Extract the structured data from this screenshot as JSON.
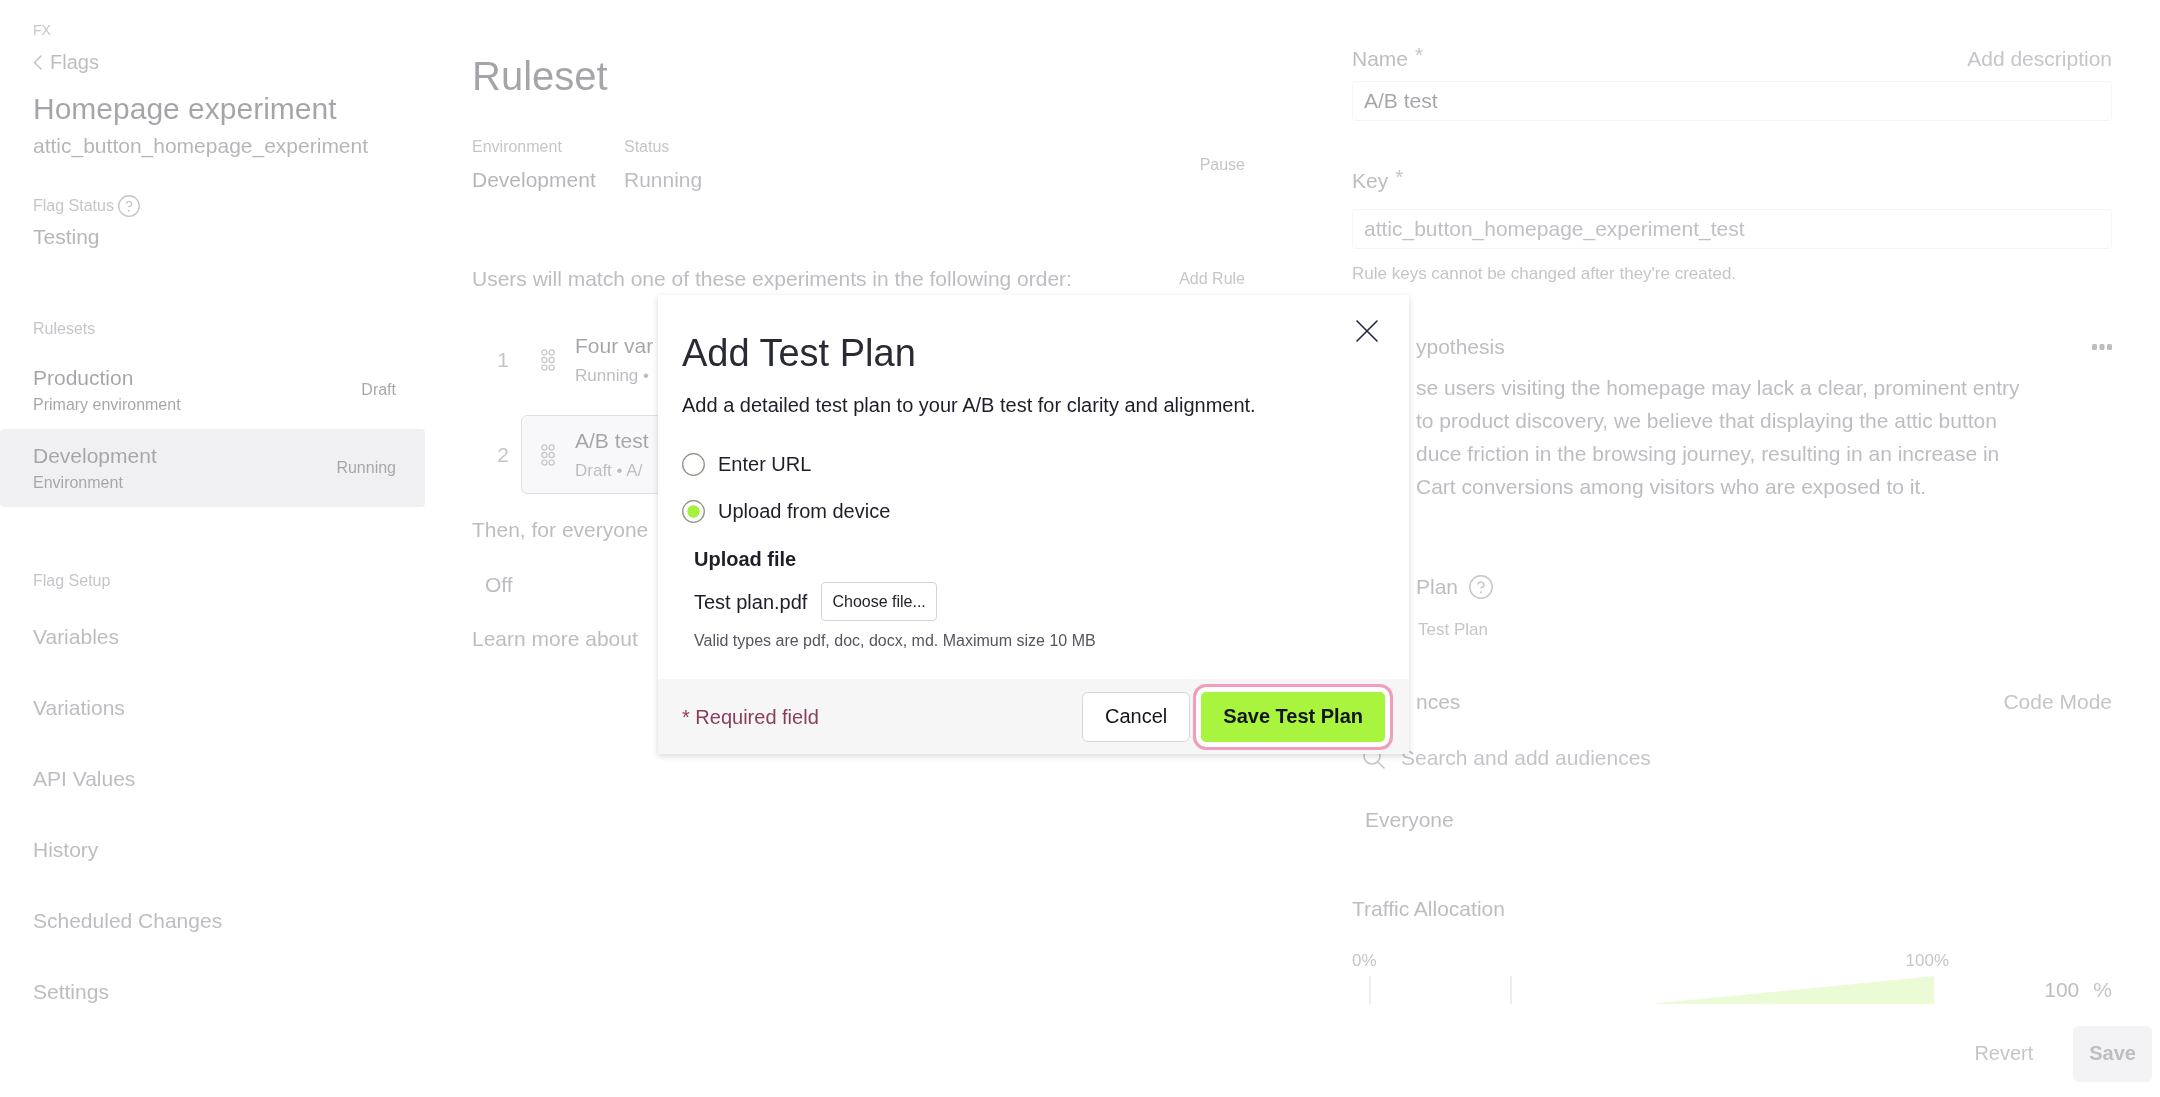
{
  "sidebar": {
    "product": "FX",
    "back_link": "Flags",
    "title": "Homepage experiment",
    "flag_key": "attic_button_homepage_experiment",
    "flag_status": {
      "label": "Flag Status",
      "value": "Testing"
    },
    "rulesets": {
      "heading": "Rulesets",
      "items": [
        {
          "name": "Production",
          "description": "Primary environment",
          "status": "Draft",
          "selected": false
        },
        {
          "name": "Development",
          "description": "Environment",
          "status": "Running",
          "selected": true
        }
      ]
    },
    "flag_setup": {
      "heading": "Flag Setup",
      "items": [
        "Variables",
        "Variations",
        "API Values",
        "History",
        "Scheduled Changes",
        "Settings"
      ]
    }
  },
  "ruleset": {
    "title": "Ruleset",
    "environment": {
      "label": "Environment",
      "value": "Development"
    },
    "status": {
      "label": "Status",
      "value": "Running"
    },
    "pause_button": "Pause",
    "order_text": "Users will match one of these experiments in the following order:",
    "add_rule_button": "Add Rule",
    "rules": [
      {
        "number": "1",
        "name": "Four var",
        "meta": "Running •",
        "selected": false
      },
      {
        "number": "2",
        "name": "A/B test",
        "meta": "Draft • A/",
        "selected": true
      }
    ],
    "fallback_text": "Then, for everyone",
    "fallback_value": "Off",
    "learn_more": "Learn more about"
  },
  "rule_editor": {
    "name": {
      "label": "Name",
      "required_mark": "*",
      "value": "A/B test"
    },
    "add_description": "Add description",
    "key": {
      "label": "Key",
      "required_mark": "*",
      "value": "attic_button_homepage_experiment_test",
      "disabled": true
    },
    "key_hint": "Rule keys cannot be changed after they're created.",
    "hypothesis": {
      "label": "ypothesis",
      "lines": [
        "se users visiting the homepage may lack a clear, prominent entry",
        "to product discovery, we believe that displaying the attic button",
        "duce friction in the browsing journey, resulting in an increase in",
        "Cart conversions among visitors who are exposed to it."
      ]
    },
    "test_plan": {
      "label": "Plan",
      "link": "Test Plan"
    },
    "audiences": {
      "label": "nces",
      "code_mode": "Code Mode",
      "search": {
        "placeholder": "Search and add audiences"
      },
      "items": [
        "Everyone"
      ]
    },
    "traffic_allocation": {
      "label": "Traffic Allocation",
      "scale_min": "0%",
      "scale_max": "100%",
      "value": "100",
      "unit": "%"
    },
    "footer": {
      "revert_button": "Revert",
      "save_button": "Save"
    }
  },
  "modal": {
    "title": "Add Test Plan",
    "description": "Add a detailed test plan to your A/B test for clarity and alignment.",
    "options": [
      {
        "label": "Enter URL",
        "selected": false
      },
      {
        "label": "Upload from device",
        "selected": true
      }
    ],
    "upload": {
      "label": "Upload file",
      "file_name": "Test plan.pdf",
      "choose_button": "Choose file...",
      "hint": "Valid types are pdf, doc, docx, md. Maximum size 10 MB"
    },
    "required_note": "* Required field",
    "buttons": [
      {
        "label": "Cancel",
        "kind": "secondary",
        "focused": false
      },
      {
        "label": "Save Test Plan",
        "kind": "primary",
        "focused": true
      }
    ]
  }
}
